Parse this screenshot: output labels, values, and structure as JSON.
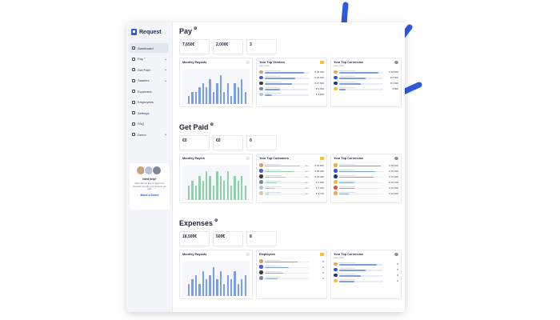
{
  "app": {
    "name": "Request"
  },
  "colors": {
    "accent": "#2d5bd9",
    "bar_blue": "#7b9fe0",
    "bar_green": "#8fcfaa",
    "gold": "#f2c230"
  },
  "sidebar": {
    "items": [
      {
        "label": "Dashboard",
        "icon": "grid-icon",
        "caret": "",
        "active": true
      },
      {
        "label": "Pay °",
        "icon": "send-icon",
        "caret": "▸"
      },
      {
        "label": "Get Paid",
        "icon": "receive-icon",
        "caret": "▸"
      },
      {
        "label": "Salaries",
        "icon": "wallet-icon",
        "caret": "▸"
      },
      {
        "label": "Expenses",
        "icon": "receipt-icon",
        "caret": ""
      },
      {
        "label": "Employees",
        "icon": "users-icon",
        "caret": ""
      },
      {
        "label": "Settings",
        "icon": "gear-icon",
        "caret": ""
      },
      {
        "label": "FAQ",
        "icon": "help-icon",
        "caret": ""
      },
      {
        "label": "Demo",
        "icon": "play-icon",
        "caret": "▸"
      }
    ],
    "demo": {
      "question": "Need help?",
      "text": "Meet with our team to learn how Request can help your business get paid.",
      "button": "Book a Demo"
    }
  },
  "sections": [
    {
      "title": "Pay",
      "subtitle": "",
      "stats": [
        {
          "value": "7,650€",
          "label": ""
        },
        {
          "value": "2,000€",
          "label": ""
        },
        {
          "value": "3",
          "label": ""
        }
      ],
      "chart_panel": {
        "title": "Monthly Payouts",
        "subtitle": "",
        "bars": [
          2,
          3,
          3,
          4,
          5,
          4,
          6,
          3,
          5,
          7,
          3,
          5,
          2,
          5,
          4,
          6,
          3
        ],
        "color": "blue"
      },
      "list1": {
        "title": "Your Top Vendors",
        "subtitle": "Last month",
        "rows": [
          {
            "value": "€ 30.000",
            "fill": 0.9
          },
          {
            "value": "€ 20.000",
            "fill": 0.7
          },
          {
            "value": "€ 17.500",
            "fill": 0.62
          },
          {
            "value": "€ 6.500",
            "fill": 0.35
          },
          {
            "value": "€ 1.800",
            "fill": 0.18
          }
        ]
      },
      "list2": {
        "title": "Your Top Currencies",
        "subtitle": "Last month",
        "rows": [
          {
            "value": "€ 16.500",
            "fill": 0.9
          },
          {
            "value": "€ 8.500",
            "fill": 0.6
          },
          {
            "value": "€ 6.000",
            "fill": 0.5
          },
          {
            "value": "€ 800",
            "fill": 0.15
          }
        ]
      }
    },
    {
      "title": "Get Paid",
      "subtitle": "",
      "stats": [
        {
          "value": "€0",
          "label": ""
        },
        {
          "value": "€0",
          "label": ""
        },
        {
          "value": "0",
          "label": ""
        }
      ],
      "chart_panel": {
        "title": "Monthly Payins",
        "subtitle": "",
        "bars": [
          3,
          4,
          3,
          5,
          4,
          6,
          5,
          3,
          6,
          5,
          4,
          6,
          3,
          5,
          4,
          5,
          3
        ],
        "color": "green"
      },
      "list1": {
        "title": "Your Top Customers",
        "subtitle": "",
        "rows": [
          {
            "value": "€ 35.800",
            "fill": 0.92
          },
          {
            "value": "€ 28.200",
            "fill": 0.75
          },
          {
            "value": "€ 18.400",
            "fill": 0.55
          },
          {
            "value": "€ 9.000",
            "fill": 0.32
          },
          {
            "value": "€ 7.200",
            "fill": 0.26
          },
          {
            "value": "€ 1.700",
            "fill": 0.12
          }
        ]
      },
      "list2": {
        "title": "Your Top Currencies",
        "subtitle": "",
        "rows": [
          {
            "value": "€ 90.000",
            "fill": 0.95
          },
          {
            "value": "€ 75.000",
            "fill": 0.82
          },
          {
            "value": "€ 70.000",
            "fill": 0.78
          },
          {
            "value": "€ 22.000",
            "fill": 0.35
          },
          {
            "value": "€ 22.000",
            "fill": 0.35
          },
          {
            "value": "€ 12.000",
            "fill": 0.22
          }
        ]
      }
    },
    {
      "title": "Expenses",
      "subtitle": "",
      "stats": [
        {
          "value": "18,500€",
          "label": ""
        },
        {
          "value": "500€",
          "label": ""
        },
        {
          "value": "8",
          "label": ""
        }
      ],
      "chart_panel": {
        "title": "Monthly Payouts",
        "subtitle": "",
        "bars": [
          3,
          4,
          5,
          3,
          6,
          4,
          5,
          7,
          4,
          6,
          3,
          5,
          4,
          6,
          3,
          4,
          5
        ],
        "color": "blue"
      },
      "list1": {
        "title": "Employees",
        "subtitle": "",
        "rows": [
          {
            "value": "€",
            "fill": 0.75
          },
          {
            "value": "€",
            "fill": 0.55
          },
          {
            "value": "€",
            "fill": 0.42
          },
          {
            "value": "€",
            "fill": 0.3
          }
        ]
      },
      "list2": {
        "title": "Your Top Currencies",
        "subtitle": "Last month",
        "rows": [
          {
            "value": "€",
            "fill": 0.85
          },
          {
            "value": "€",
            "fill": 0.6
          },
          {
            "value": "€",
            "fill": 0.5
          },
          {
            "value": "€",
            "fill": 0.35
          }
        ]
      }
    }
  ]
}
